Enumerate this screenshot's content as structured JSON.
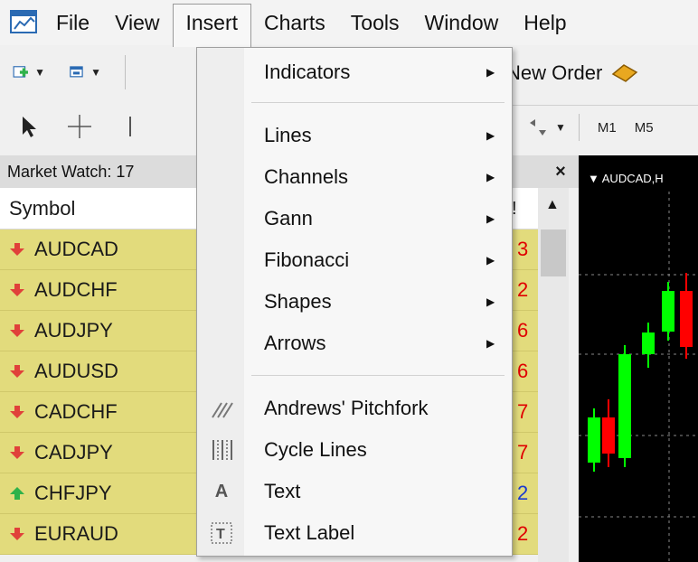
{
  "menubar": {
    "items": [
      "File",
      "View",
      "Insert",
      "Charts",
      "Tools",
      "Window",
      "Help"
    ]
  },
  "toolbar": {
    "new_order_label": "New Order",
    "timeframes": [
      "M1",
      "M5"
    ]
  },
  "market_watch": {
    "title": "Market Watch: 17",
    "column_symbol": "Symbol",
    "column_bang": "!",
    "rows": [
      {
        "symbol": "AUDCAD",
        "direction": "down",
        "tail": "3",
        "tail_color": "#e00000"
      },
      {
        "symbol": "AUDCHF",
        "direction": "down",
        "tail": "2",
        "tail_color": "#e00000"
      },
      {
        "symbol": "AUDJPY",
        "direction": "down",
        "tail": "6",
        "tail_color": "#e00000"
      },
      {
        "symbol": "AUDUSD",
        "direction": "down",
        "tail": "6",
        "tail_color": "#e00000"
      },
      {
        "symbol": "CADCHF",
        "direction": "down",
        "tail": "7",
        "tail_color": "#e00000"
      },
      {
        "symbol": "CADJPY",
        "direction": "down",
        "tail": "7",
        "tail_color": "#e00000"
      },
      {
        "symbol": "CHFJPY",
        "direction": "up",
        "tail": "2",
        "tail_color": "#1a3ad0"
      },
      {
        "symbol": "EURAUD",
        "direction": "down",
        "tail": "2",
        "tail_color": "#e00000"
      }
    ]
  },
  "chart": {
    "title": "AUDCAD,H"
  },
  "insert_menu": {
    "items": [
      {
        "label": "Indicators",
        "submenu": true,
        "icon": ""
      },
      {
        "label": "Lines",
        "submenu": true,
        "icon": ""
      },
      {
        "label": "Channels",
        "submenu": true,
        "icon": ""
      },
      {
        "label": "Gann",
        "submenu": true,
        "icon": ""
      },
      {
        "label": "Fibonacci",
        "submenu": true,
        "icon": ""
      },
      {
        "label": "Shapes",
        "submenu": true,
        "icon": ""
      },
      {
        "label": "Arrows",
        "submenu": true,
        "icon": ""
      },
      {
        "label": "Andrews' Pitchfork",
        "submenu": false,
        "icon": "pitchfork-icon"
      },
      {
        "label": "Cycle Lines",
        "submenu": false,
        "icon": "cycle-lines-icon"
      },
      {
        "label": "Text",
        "submenu": false,
        "icon": "text-icon"
      },
      {
        "label": "Text Label",
        "submenu": false,
        "icon": "text-label-icon"
      }
    ]
  },
  "colors": {
    "row_bg": "#e2db7c",
    "up": "#2fb24a",
    "down": "#e0413a",
    "bull_candle": "#00ff00",
    "bear_candle": "#ff0000"
  }
}
